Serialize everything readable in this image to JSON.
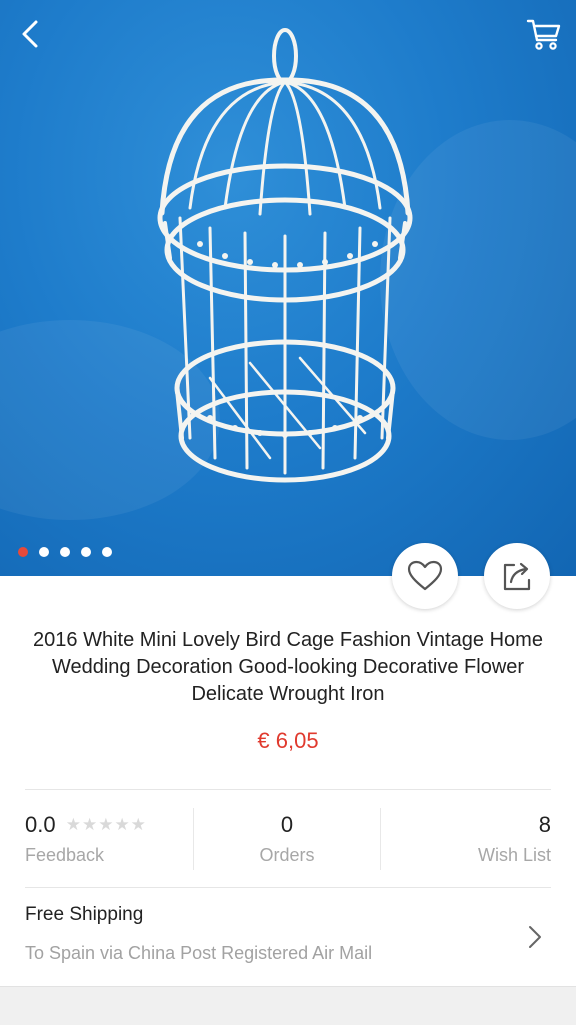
{
  "product": {
    "title": "2016 White Mini Lovely Bird Cage Fashion Vintage Home Wedding Decoration Good-looking Decorative Flower Delicate Wrought Iron",
    "price": "€ 6,05",
    "image_alt": "White wrought iron bird cage on blue cloth"
  },
  "gallery": {
    "total_images": 5,
    "active_index": 0
  },
  "stats": {
    "rating": "0.0",
    "stars": "★★★★★",
    "feedback_label": "Feedback",
    "orders": "0",
    "orders_label": "Orders",
    "wishlist": "8",
    "wishlist_label": "Wish List"
  },
  "shipping": {
    "title": "Free Shipping",
    "details": "To Spain via China Post Registered Air Mail"
  },
  "icons": {
    "back": "chevron-left-icon",
    "cart": "cart-icon",
    "wish": "heart-icon",
    "share": "share-icon",
    "shipping_arrow": "chevron-right-icon"
  },
  "colors": {
    "price": "#e03a2e",
    "active_dot": "#e64a3b",
    "hero_bg": "#1e7ccb"
  }
}
